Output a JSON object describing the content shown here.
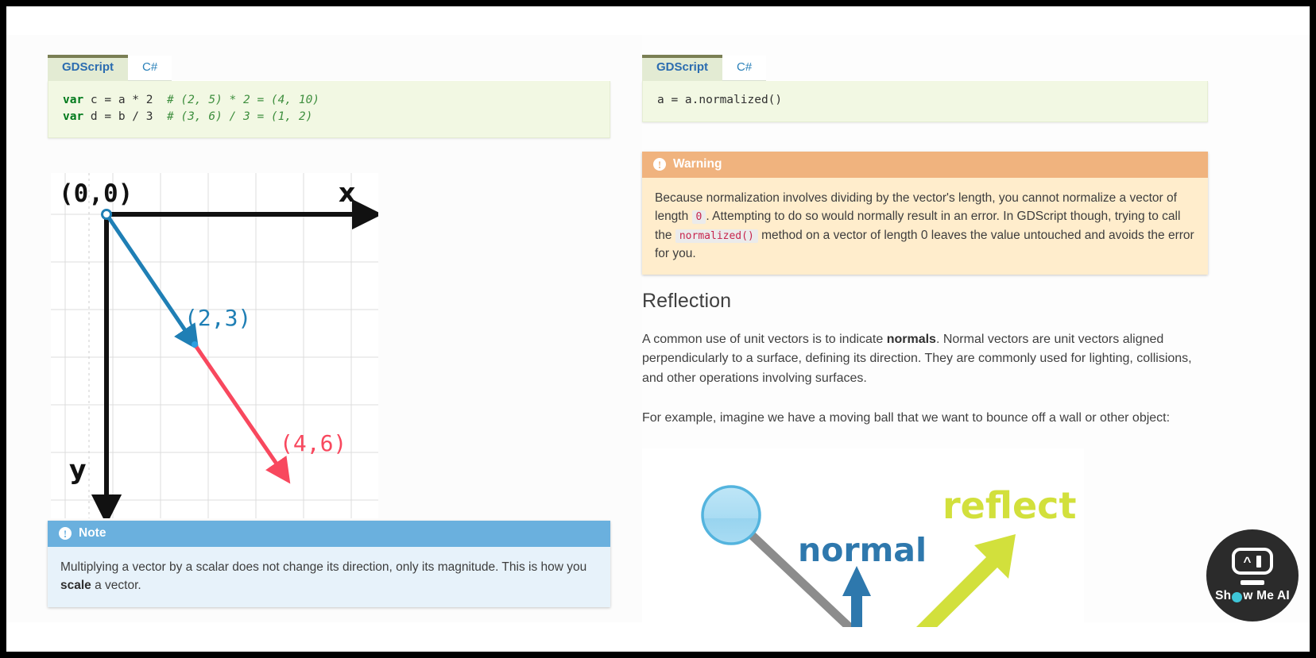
{
  "left": {
    "tabs": [
      {
        "label": "GDScript",
        "active": true
      },
      {
        "label": "C#",
        "active": false
      }
    ],
    "code": {
      "lines": [
        {
          "kw": "var",
          "plain": " c = a * 2  ",
          "comment": "# (2, 5) * 2 = (4, 10)"
        },
        {
          "kw": "var",
          "plain": " d = b / 3  ",
          "comment": "# (3, 6) / 3 = (1, 2)"
        }
      ]
    },
    "diagram": {
      "type": "vector-diagram",
      "origin_label": "(0,0)",
      "x_axis_label": "x",
      "y_axis_label": "y",
      "vectors": [
        {
          "label": "(2,3)",
          "color": "#1f7fb5",
          "from": [
            0,
            0
          ],
          "to": [
            2,
            3
          ]
        },
        {
          "label": "(4,6)",
          "color": "#f8485e",
          "from": [
            2,
            3
          ],
          "to": [
            4,
            6
          ]
        }
      ]
    },
    "note": {
      "icon": "info-icon",
      "title": "Note",
      "text_before": "Multiplying a vector by a scalar does not change its direction, only its magnitude. This is how you ",
      "bold": "scale",
      "text_after": " a vector."
    }
  },
  "right": {
    "tabs": [
      {
        "label": "GDScript",
        "active": true
      },
      {
        "label": "C#",
        "active": false
      }
    ],
    "code": {
      "line": "a = a.normalized()"
    },
    "warning": {
      "icon": "warning-icon",
      "title": "Warning",
      "seg1": "Because normalization involves dividing by the vector's length, you cannot normalize a vector of length ",
      "code1": "0",
      "seg2": ". Attempting to do so would normally result in an error. In GDScript though, trying to call the ",
      "code2": "normalized()",
      "seg3": " method on a vector of length 0 leaves the value untouched and avoids the error for you."
    },
    "heading": "Reflection",
    "paragraph1_a": "A common use of unit vectors is to indicate ",
    "paragraph1_bold": "normals",
    "paragraph1_b": ". Normal vectors are unit vectors aligned perpendicularly to a surface, defining its direction. They are commonly used for lighting, collisions, and other operations involving surfaces.",
    "paragraph2": "For example, imagine we have a moving ball that we want to bounce off a wall or other object:",
    "illustration": {
      "normal_label": "normal",
      "reflect_label": "reflect",
      "normal_color": "#2e78ad",
      "reflect_color": "#d2e03c",
      "ball_color": "#aadcf0",
      "path_color": "#8c8c8c"
    }
  },
  "watermark": {
    "text_before": "Sh",
    "o_icon": "cyan-dot-o",
    "text_after": "w Me AI",
    "face_icon": "robot-face-icon"
  }
}
